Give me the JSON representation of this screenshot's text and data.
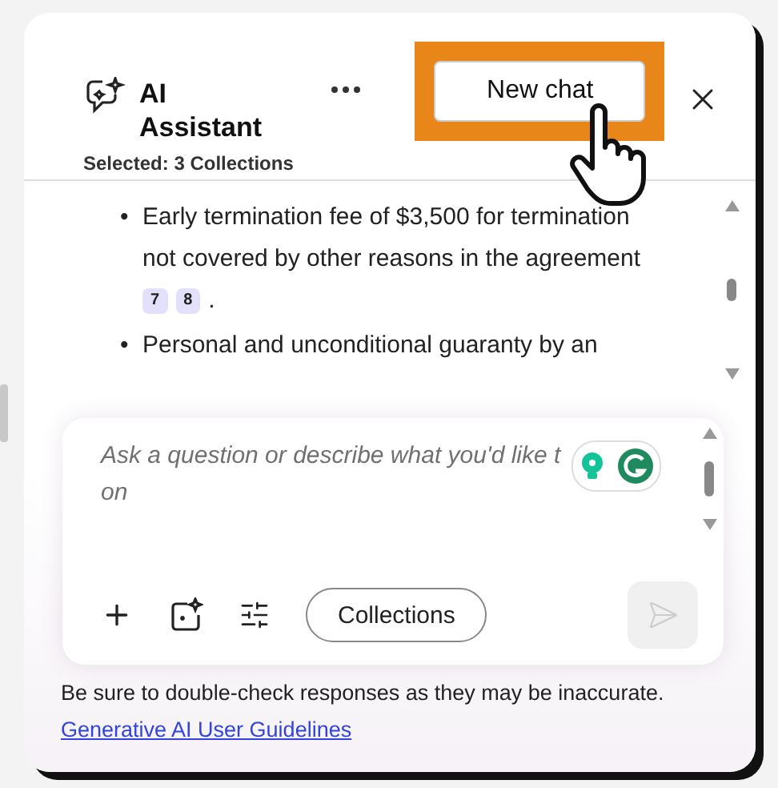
{
  "header": {
    "title_lines": [
      "AI",
      "Assistant"
    ],
    "subtitle_label": "Selected:",
    "subtitle_value": "3 Collections",
    "new_chat_button": "New chat",
    "highlighted": true
  },
  "messages": [
    {
      "kind": "bullet",
      "marker": "•",
      "text": "Early termination fee of $3,500 for termination not covered by other reasons in the agreement",
      "citations": [
        "7",
        "8"
      ],
      "end": "."
    },
    {
      "kind": "bullet",
      "marker": "•",
      "text": "Personal and unconditional guaranty by an"
    }
  ],
  "composer": {
    "placeholder_lines": [
      "Ask a question or describe what you'd like t",
      "on"
    ],
    "collections_button": "Collections",
    "send_disabled": true
  },
  "footer": {
    "disclaimer": "Be sure to double-check responses as they may be inaccurate.",
    "link": "Generative AI User Guidelines"
  }
}
